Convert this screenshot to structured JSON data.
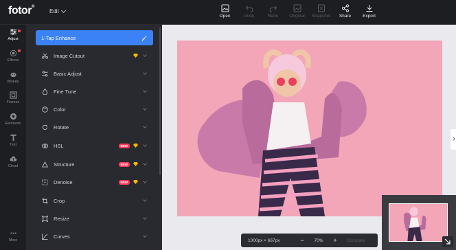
{
  "app": {
    "logo": "fotor",
    "logo_mark": "®",
    "edit_menu": "Edit"
  },
  "toolbar": [
    {
      "label": "Open",
      "icon": "open-image-icon",
      "enabled": true
    },
    {
      "label": "Undo",
      "icon": "undo-icon",
      "enabled": false
    },
    {
      "label": "Redo",
      "icon": "redo-icon",
      "enabled": false
    },
    {
      "label": "Original",
      "icon": "original-icon",
      "enabled": false
    },
    {
      "label": "Snapshot",
      "icon": "snapshot-icon",
      "enabled": false
    },
    {
      "label": "Share",
      "icon": "share-icon",
      "enabled": true
    },
    {
      "label": "Export",
      "icon": "download-icon",
      "enabled": true
    }
  ],
  "rail": [
    {
      "label": "Adjust",
      "icon": "sliders-icon",
      "active": true,
      "dot": true
    },
    {
      "label": "Effects",
      "icon": "effects-icon",
      "active": false,
      "dot": true
    },
    {
      "label": "Beauty",
      "icon": "beauty-icon",
      "active": false,
      "dot": false
    },
    {
      "label": "Frames",
      "icon": "frames-icon",
      "active": false,
      "dot": false
    },
    {
      "label": "Elements",
      "icon": "elements-icon",
      "active": false,
      "dot": false
    },
    {
      "label": "Text",
      "icon": "text-icon",
      "active": false,
      "dot": false
    },
    {
      "label": "Cloud",
      "icon": "cloud-icon",
      "active": false,
      "dot": false
    },
    {
      "label": "More",
      "icon": "more-icon",
      "active": false,
      "dot": false
    }
  ],
  "panel": {
    "items": [
      {
        "label": "1-Tap Enhance",
        "icon": "magic-wand-icon",
        "primary": true,
        "new": false,
        "premium": false
      },
      {
        "label": "Image Cutout",
        "icon": "scissors-icon",
        "primary": false,
        "new": false,
        "premium": true
      },
      {
        "label": "Basic Adjust",
        "icon": "sliders-icon",
        "primary": false,
        "new": false,
        "premium": false
      },
      {
        "label": "Fine Tune",
        "icon": "drop-icon",
        "primary": false,
        "new": false,
        "premium": false
      },
      {
        "label": "Color",
        "icon": "palette-icon",
        "primary": false,
        "new": false,
        "premium": false
      },
      {
        "label": "Rotate",
        "icon": "rotate-icon",
        "primary": false,
        "new": false,
        "premium": false
      },
      {
        "label": "HSL",
        "icon": "hsl-icon",
        "primary": false,
        "new": true,
        "premium": true
      },
      {
        "label": "Structure",
        "icon": "triangle-icon",
        "primary": false,
        "new": true,
        "premium": true
      },
      {
        "label": "Denoise",
        "icon": "denoise-icon",
        "primary": false,
        "new": true,
        "premium": true
      },
      {
        "label": "Crop",
        "icon": "crop-icon",
        "primary": false,
        "new": false,
        "premium": false
      },
      {
        "label": "Resize",
        "icon": "resize-icon",
        "primary": false,
        "new": false,
        "premium": false
      },
      {
        "label": "Curves",
        "icon": "curves-icon",
        "primary": false,
        "new": false,
        "premium": false
      }
    ],
    "new_badge": "NEW"
  },
  "canvas": {
    "dimensions": "1000px × 667px",
    "zoom": "70%",
    "zoom_out": "−",
    "zoom_in": "+",
    "compare": "Compare"
  },
  "colors": {
    "accent": "#3b82f6",
    "photo_bg": "#f2a6b8",
    "new_badge": "#ff3b5c",
    "premium": "#f5b800"
  }
}
